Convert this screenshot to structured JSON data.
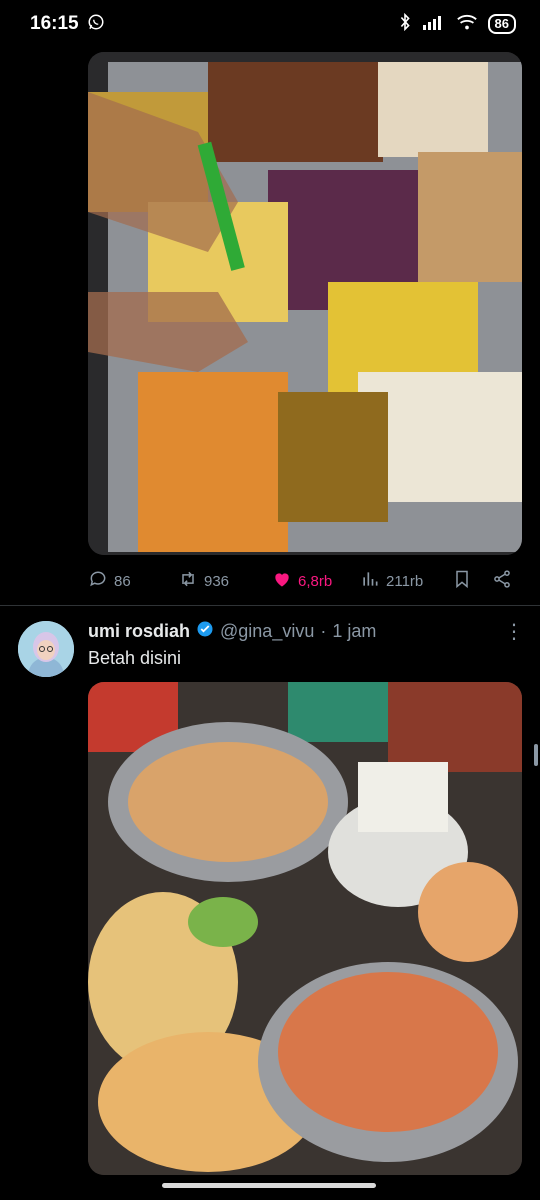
{
  "status_bar": {
    "time": "16:15",
    "battery": "86",
    "icons": [
      "whatsapp-icon",
      "bluetooth-icon",
      "signal-icon",
      "wifi-icon",
      "battery-icon"
    ]
  },
  "tweet1": {
    "photo_label": "Photo",
    "stats": {
      "replies": "86",
      "retweets": "936",
      "likes": "6,8rb",
      "views": "211rb"
    }
  },
  "tweet2": {
    "name": "umi rosdiah",
    "handle": "@gina_vivu",
    "separator": "·",
    "time_ago": "1 jam",
    "text": "Betah disini",
    "photo_label": "Photo"
  },
  "colors": {
    "like": "#f91880",
    "muted": "#8b98a5",
    "verified": "#1d9bf0"
  }
}
